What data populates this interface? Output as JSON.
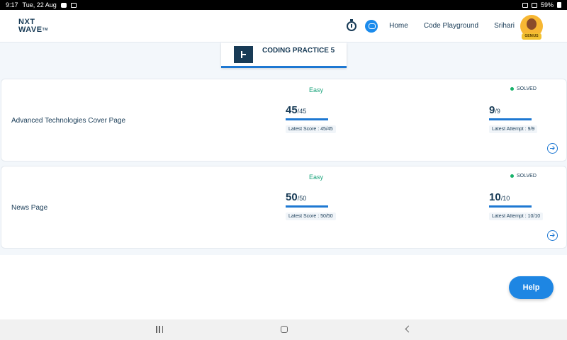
{
  "status_bar": {
    "time": "9:17",
    "date": "Tue, 22 Aug",
    "battery": "59%"
  },
  "header": {
    "logo_line1": "NXT",
    "logo_line2": "WAVE",
    "logo_tm": "TM",
    "nav_home": "Home",
    "nav_playground": "Code Playground",
    "user_name": "Srihari",
    "avatar_badge": "GENIUS"
  },
  "practice": {
    "title": "CODING PRACTICE 5"
  },
  "questions": [
    {
      "title": "Advanced Technologies Cover Page",
      "difficulty": "Easy",
      "status": "SOLVED",
      "score": "45",
      "score_total": "/45",
      "score_label": "Latest Score : 45/45",
      "attempt": "9",
      "attempt_total": "/9",
      "attempt_label": "Latest Attempt : 9/9"
    },
    {
      "title": "News Page",
      "difficulty": "Easy",
      "status": "SOLVED",
      "score": "50",
      "score_total": "/50",
      "score_label": "Latest Score : 50/50",
      "attempt": "10",
      "attempt_total": "/10",
      "attempt_label": "Latest Attempt : 10/10"
    }
  ],
  "help": {
    "label": "Help"
  },
  "colors": {
    "primary": "#1e78d2",
    "heading": "#183b56",
    "easy": "#17a37a",
    "solved_dot": "#17b26a"
  },
  "icons": [
    "stopwatch-icon",
    "chat-icon",
    "collapse-icon",
    "arrow-right-circle-icon"
  ]
}
